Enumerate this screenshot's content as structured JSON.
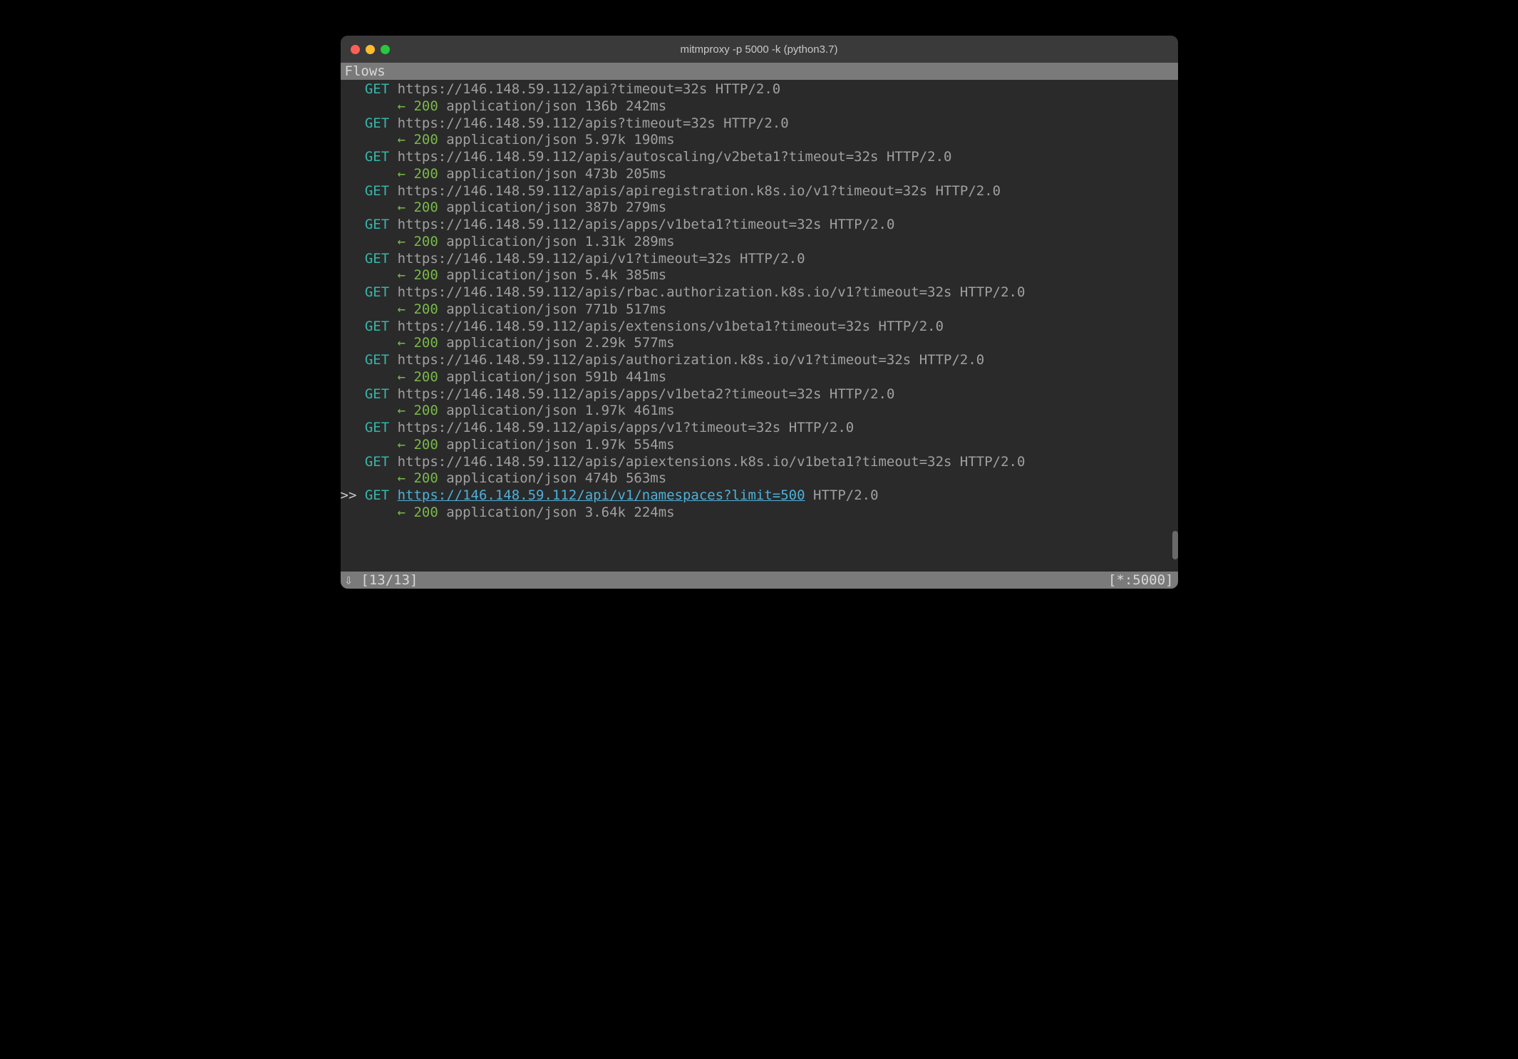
{
  "window": {
    "title": "mitmproxy -p 5000 -k (python3.7)"
  },
  "header": "Flows",
  "flows": [
    {
      "method": "GET",
      "url": "https://146.148.59.112/api?timeout=32s",
      "proto": "HTTP/2.0",
      "status": "200",
      "ctype": "application/json",
      "size": "136b",
      "time": "242ms",
      "selected": false
    },
    {
      "method": "GET",
      "url": "https://146.148.59.112/apis?timeout=32s",
      "proto": "HTTP/2.0",
      "status": "200",
      "ctype": "application/json",
      "size": "5.97k",
      "time": "190ms",
      "selected": false
    },
    {
      "method": "GET",
      "url": "https://146.148.59.112/apis/autoscaling/v2beta1?timeout=32s",
      "proto": "HTTP/2.0",
      "status": "200",
      "ctype": "application/json",
      "size": "473b",
      "time": "205ms",
      "selected": false
    },
    {
      "method": "GET",
      "url": "https://146.148.59.112/apis/apiregistration.k8s.io/v1?timeout=32s",
      "proto": "HTTP/2.0",
      "status": "200",
      "ctype": "application/json",
      "size": "387b",
      "time": "279ms",
      "selected": false
    },
    {
      "method": "GET",
      "url": "https://146.148.59.112/apis/apps/v1beta1?timeout=32s",
      "proto": "HTTP/2.0",
      "status": "200",
      "ctype": "application/json",
      "size": "1.31k",
      "time": "289ms",
      "selected": false
    },
    {
      "method": "GET",
      "url": "https://146.148.59.112/api/v1?timeout=32s",
      "proto": "HTTP/2.0",
      "status": "200",
      "ctype": "application/json",
      "size": "5.4k",
      "time": "385ms",
      "selected": false
    },
    {
      "method": "GET",
      "url": "https://146.148.59.112/apis/rbac.authorization.k8s.io/v1?timeout=32s",
      "proto": "HTTP/2.0",
      "status": "200",
      "ctype": "application/json",
      "size": "771b",
      "time": "517ms",
      "selected": false
    },
    {
      "method": "GET",
      "url": "https://146.148.59.112/apis/extensions/v1beta1?timeout=32s",
      "proto": "HTTP/2.0",
      "status": "200",
      "ctype": "application/json",
      "size": "2.29k",
      "time": "577ms",
      "selected": false
    },
    {
      "method": "GET",
      "url": "https://146.148.59.112/apis/authorization.k8s.io/v1?timeout=32s",
      "proto": "HTTP/2.0",
      "status": "200",
      "ctype": "application/json",
      "size": "591b",
      "time": "441ms",
      "selected": false
    },
    {
      "method": "GET",
      "url": "https://146.148.59.112/apis/apps/v1beta2?timeout=32s",
      "proto": "HTTP/2.0",
      "status": "200",
      "ctype": "application/json",
      "size": "1.97k",
      "time": "461ms",
      "selected": false
    },
    {
      "method": "GET",
      "url": "https://146.148.59.112/apis/apps/v1?timeout=32s",
      "proto": "HTTP/2.0",
      "status": "200",
      "ctype": "application/json",
      "size": "1.97k",
      "time": "554ms",
      "selected": false
    },
    {
      "method": "GET",
      "url": "https://146.148.59.112/apis/apiextensions.k8s.io/v1beta1?timeout=32s",
      "proto": "HTTP/2.0",
      "status": "200",
      "ctype": "application/json",
      "size": "474b",
      "time": "563ms",
      "selected": false
    },
    {
      "method": "GET",
      "url": "https://146.148.59.112/api/v1/namespaces?limit=500",
      "proto": "HTTP/2.0",
      "status": "200",
      "ctype": "application/json",
      "size": "3.64k",
      "time": "224ms",
      "selected": true
    }
  ],
  "status_bar": {
    "follow_icon": "⇩",
    "counter": "[13/13]",
    "listen": "[*:5000]"
  },
  "selection_marker": ">>"
}
